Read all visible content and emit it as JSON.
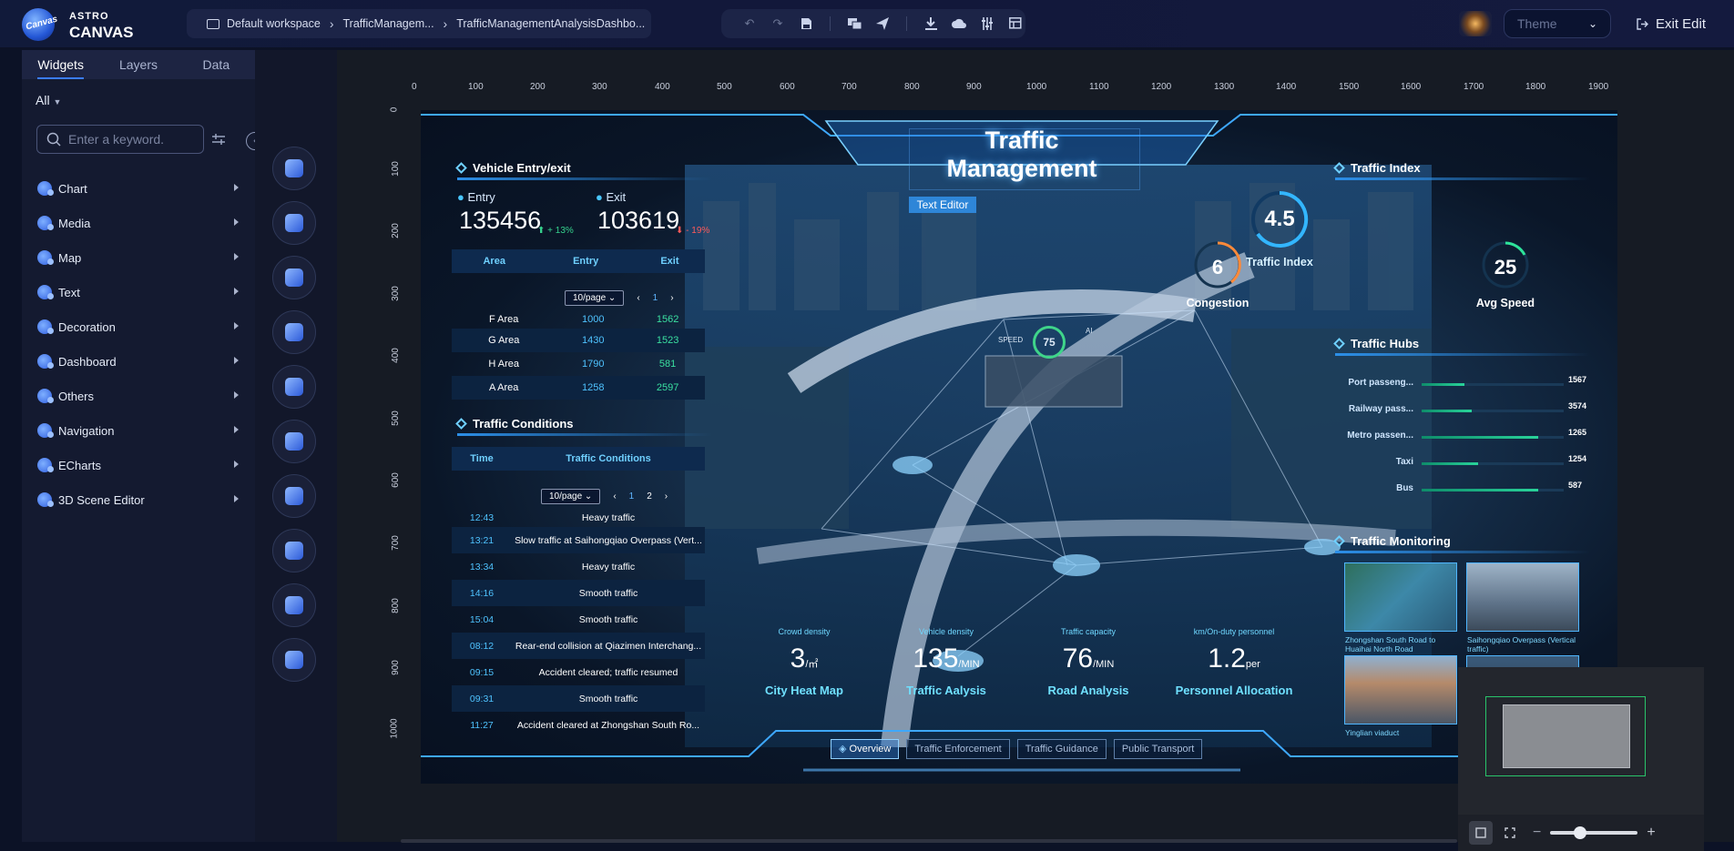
{
  "app": {
    "logo_small": "ASTRO",
    "logo_big": "CANVAS",
    "logo_badge": "Canvas"
  },
  "breadcrumb": [
    "Default workspace",
    "TrafficManagem...",
    "TrafficManagementAnalysisDashbo..."
  ],
  "toolbar_icons": [
    "undo-icon",
    "redo-icon",
    "save-icon",
    "preview-icon",
    "publish-icon",
    "download-icon",
    "cloud-icon",
    "settings-icon",
    "layout-icon"
  ],
  "theme": {
    "placeholder": "Theme"
  },
  "exit_label": "Exit Edit",
  "sidebar": {
    "tabs": [
      "Widgets",
      "Layers",
      "Data"
    ],
    "filter": "All",
    "search_placeholder": "Enter a keyword.",
    "categories": [
      "Chart",
      "Media",
      "Map",
      "Text",
      "Decoration",
      "Dashboard",
      "Others",
      "Navigation",
      "ECharts",
      "3D Scene Editor"
    ]
  },
  "ruler": {
    "h": [
      "0",
      "100",
      "200",
      "300",
      "400",
      "500",
      "600",
      "700",
      "800",
      "900",
      "1000",
      "1100",
      "1200",
      "1300",
      "1400",
      "1500",
      "1600",
      "1700",
      "1800",
      "1900"
    ],
    "v": [
      "0",
      "100",
      "200",
      "300",
      "400",
      "500",
      "600",
      "700",
      "800",
      "900",
      "1000"
    ]
  },
  "dashboard": {
    "title": "Traffic Management",
    "text_editor_tag": "Text Editor",
    "vehicle": {
      "title": "Vehicle Entry/exit",
      "entry_label": "Entry",
      "entry_value": "135456",
      "entry_delta": "+ 13%",
      "exit_label": "Exit",
      "exit_value": "103619",
      "exit_delta": "- 19%",
      "headers": [
        "Area",
        "Entry",
        "Exit"
      ],
      "page_size": "10/page",
      "page": "1",
      "rows": [
        [
          "F Area",
          "1000",
          "1562"
        ],
        [
          "G Area",
          "1430",
          "1523"
        ],
        [
          "H Area",
          "1790",
          "581"
        ],
        [
          "A Area",
          "1258",
          "2597"
        ]
      ]
    },
    "conditions": {
      "title": "Traffic Conditions",
      "headers": [
        "Time",
        "Traffic Conditions"
      ],
      "page_size": "10/page",
      "pages": [
        "1",
        "2"
      ],
      "rows": [
        [
          "12:43",
          "Heavy traffic"
        ],
        [
          "13:21",
          "Slow traffic at Saihongqiao Overpass (Vert..."
        ],
        [
          "13:34",
          "Heavy traffic"
        ],
        [
          "14:16",
          "Smooth traffic"
        ],
        [
          "15:04",
          "Smooth traffic"
        ],
        [
          "08:12",
          "Rear-end collision at Qiazimen Interchang..."
        ],
        [
          "09:15",
          "Accident cleared; traffic resumed"
        ],
        [
          "09:31",
          "Smooth traffic"
        ],
        [
          "11:27",
          "Accident cleared at Zhongshan South Ro..."
        ]
      ]
    },
    "index": {
      "title": "Traffic Index",
      "main_value": "4.5",
      "main_label": "Traffic Index",
      "congestion_value": "6",
      "congestion_label": "Congestion",
      "speed_value": "25",
      "speed_label": "Avg Speed"
    },
    "hubs": {
      "title": "Traffic Hubs",
      "items": [
        {
          "name": "Port passeng...",
          "value": "1567",
          "fraction": 0.3
        },
        {
          "name": "Railway pass...",
          "value": "3574",
          "fraction": 0.35
        },
        {
          "name": "Metro passen...",
          "value": "1265",
          "fraction": 0.82
        },
        {
          "name": "Taxi",
          "value": "1254",
          "fraction": 0.4
        },
        {
          "name": "Bus",
          "value": "587",
          "fraction": 0.82
        }
      ]
    },
    "monitoring": {
      "title": "Traffic Monitoring",
      "cams": [
        "Zhongshan South Road to Huaihai North Road",
        "Saihongqiao Overpass (Vertical traffic)",
        "Yinglian viaduct",
        ""
      ]
    },
    "pods": [
      {
        "label": "Crowd density",
        "value": "3",
        "unit": "/㎡",
        "title": "City Heat Map"
      },
      {
        "label": "Vehicle density",
        "value": "135",
        "unit": "/MIN",
        "title": "Traffic Aalysis"
      },
      {
        "label": "Traffic capacity",
        "value": "76",
        "unit": "/MIN",
        "title": "Road Analysis"
      },
      {
        "label": "km/On-duty personnel",
        "value": "1.2",
        "unit": "per",
        "title": "Personnel Allocation"
      }
    ],
    "overlay": {
      "speed_label": "SPEED",
      "speed_value": "75",
      "ai_label": "AI"
    },
    "nav": [
      "Overview",
      "Traffic Enforcement",
      "Traffic Guidance",
      "Public Transport"
    ]
  }
}
